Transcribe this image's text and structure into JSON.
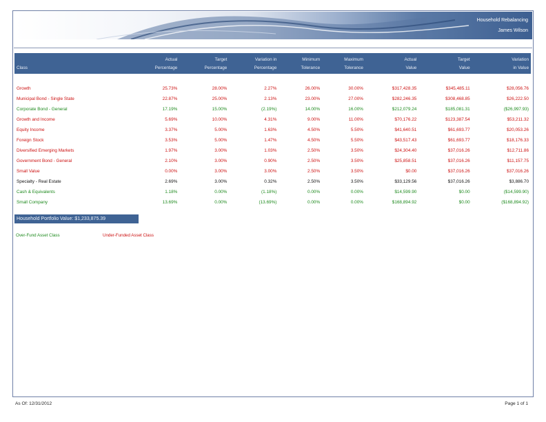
{
  "header": {
    "title": "Household Rebalancing",
    "client": "James Wilson"
  },
  "table": {
    "columns": [
      {
        "line1": "",
        "line2": "Class"
      },
      {
        "line1": "Actual",
        "line2": "Percentage"
      },
      {
        "line1": "Target",
        "line2": "Percentage"
      },
      {
        "line1": "Variation in",
        "line2": "Percentage"
      },
      {
        "line1": "Minimum",
        "line2": "Tolerance"
      },
      {
        "line1": "Maximum",
        "line2": "Tolerance"
      },
      {
        "line1": "Actual",
        "line2": "Value"
      },
      {
        "line1": "Target",
        "line2": "Value"
      },
      {
        "line1": "Variation",
        "line2": "in Value"
      }
    ],
    "rows": [
      {
        "status": "under",
        "cells": [
          "Growth",
          "25.73%",
          "28.00%",
          "2.27%",
          "26.00%",
          "30.00%",
          "$317,428.35",
          "$345,485.11",
          "$28,056.76"
        ]
      },
      {
        "status": "under",
        "cells": [
          "Municipal Bond - Single State",
          "22.87%",
          "25.00%",
          "2.13%",
          "23.00%",
          "27.00%",
          "$282,246.35",
          "$308,468.85",
          "$26,222.50"
        ]
      },
      {
        "status": "over",
        "cells": [
          "Corporate Bond - General",
          "17.19%",
          "15.00%",
          "(2.19%)",
          "14.00%",
          "16.00%",
          "$212,079.24",
          "$185,081.31",
          "($26,997.93)"
        ]
      },
      {
        "status": "under",
        "cells": [
          "Growth and Income",
          "5.69%",
          "10.00%",
          "4.31%",
          "9.00%",
          "11.00%",
          "$70,176.22",
          "$123,387.54",
          "$53,211.32"
        ]
      },
      {
        "status": "under",
        "cells": [
          "Equity Income",
          "3.37%",
          "5.00%",
          "1.63%",
          "4.50%",
          "5.50%",
          "$41,640.51",
          "$61,693.77",
          "$20,053.26"
        ]
      },
      {
        "status": "under",
        "cells": [
          "Foreign Stock",
          "3.53%",
          "5.00%",
          "1.47%",
          "4.50%",
          "5.50%",
          "$43,517.43",
          "$61,693.77",
          "$18,176.33"
        ]
      },
      {
        "status": "under",
        "cells": [
          "Diversified Emerging Markets",
          "1.97%",
          "3.00%",
          "1.03%",
          "2.50%",
          "3.50%",
          "$24,304.40",
          "$37,016.26",
          "$12,711.86"
        ]
      },
      {
        "status": "under",
        "cells": [
          "Government Bond - General",
          "2.10%",
          "3.00%",
          "0.90%",
          "2.50%",
          "3.50%",
          "$25,858.51",
          "$37,016.26",
          "$11,157.75"
        ]
      },
      {
        "status": "under",
        "cells": [
          "Small Value",
          "0.00%",
          "3.00%",
          "3.00%",
          "2.50%",
          "3.50%",
          "$0.00",
          "$37,016.26",
          "$37,016.26"
        ]
      },
      {
        "status": "neutral",
        "cells": [
          "Specialty - Real Estate",
          "2.69%",
          "3.00%",
          "0.32%",
          "2.50%",
          "3.50%",
          "$33,129.56",
          "$37,016.26",
          "$3,886.70"
        ]
      },
      {
        "status": "over",
        "cells": [
          "Cash & Equivalents",
          "1.18%",
          "0.00%",
          "(1.18%)",
          "0.00%",
          "0.00%",
          "$14,599.90",
          "$0.00",
          "($14,599.90)"
        ]
      },
      {
        "status": "over",
        "cells": [
          "Small Company",
          "13.69%",
          "0.00%",
          "(13.69%)",
          "0.00%",
          "0.00%",
          "$168,894.92",
          "$0.00",
          "($168,894.92)"
        ]
      }
    ]
  },
  "portfolio_value": "Household Portfolio Value: $1,233,875.39",
  "legend": {
    "over_label": "Over-Fund Asset Class",
    "under_label": "Under-Funded Asset Class"
  },
  "footer": {
    "as_of": "As Of: 12/31/2012",
    "page": "Page 1 of 1"
  },
  "colors": {
    "header_blue": "#3f6394",
    "over": "#1e8a1e",
    "under": "#cc1111"
  }
}
